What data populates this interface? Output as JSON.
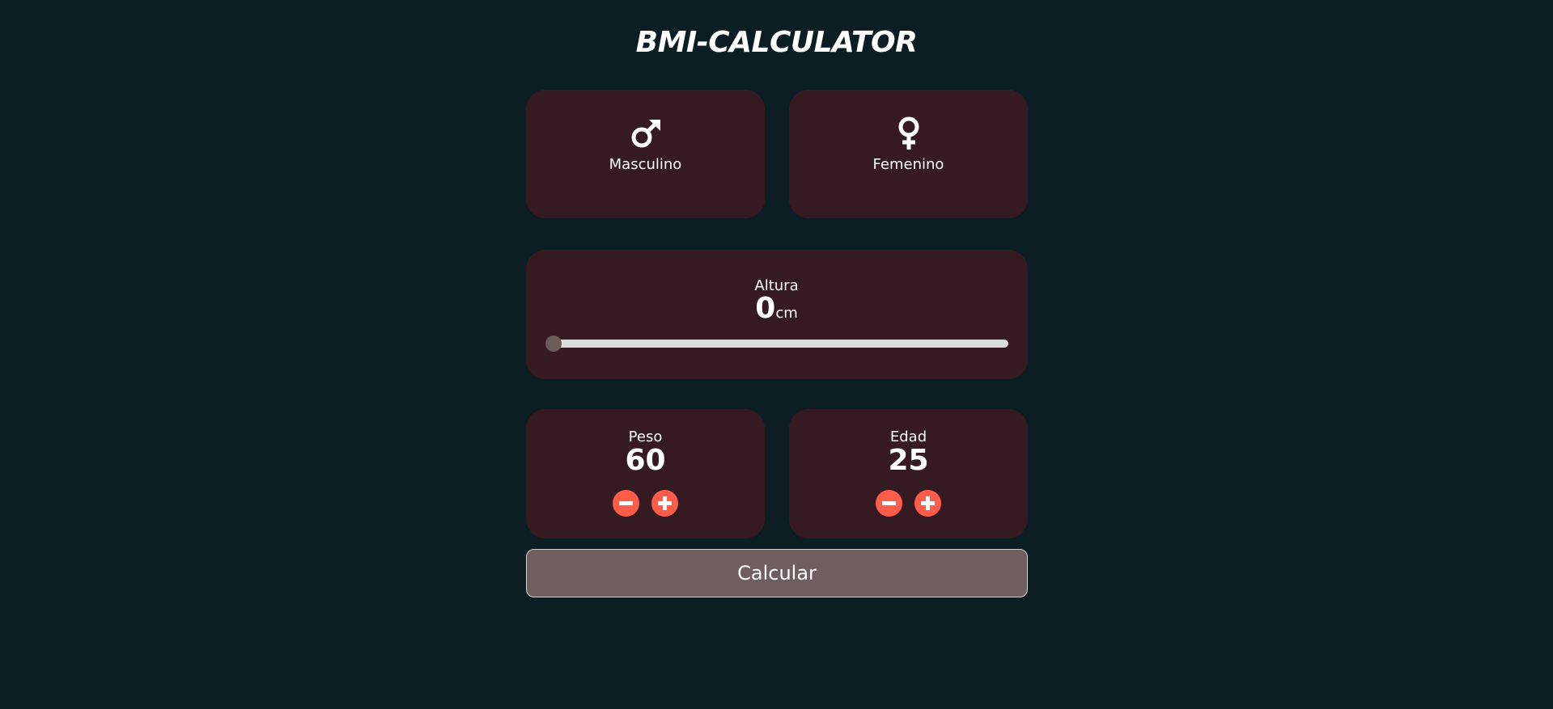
{
  "app": {
    "title": "BMI-CALCULATOR"
  },
  "gender": {
    "male": {
      "label": "Masculino",
      "icon": "male-symbol-icon"
    },
    "female": {
      "label": "Femenino",
      "icon": "female-symbol-icon"
    }
  },
  "height": {
    "label": "Altura",
    "value": "0",
    "unit": "cm",
    "slider_fraction": 0
  },
  "weight": {
    "label": "Peso",
    "value": "60",
    "decrement_icon": "minus-icon",
    "increment_icon": "plus-icon"
  },
  "age": {
    "label": "Edad",
    "value": "25",
    "decrement_icon": "minus-icon",
    "increment_icon": "plus-icon"
  },
  "actions": {
    "calculate_label": "Calcular"
  },
  "colors": {
    "background": "#0c1d23",
    "card": "#351b21",
    "accent": "#ff5c4a",
    "button": "#705d5d",
    "slider_thumb": "#6c5b5b",
    "slider_track": "#dcdcdc"
  }
}
